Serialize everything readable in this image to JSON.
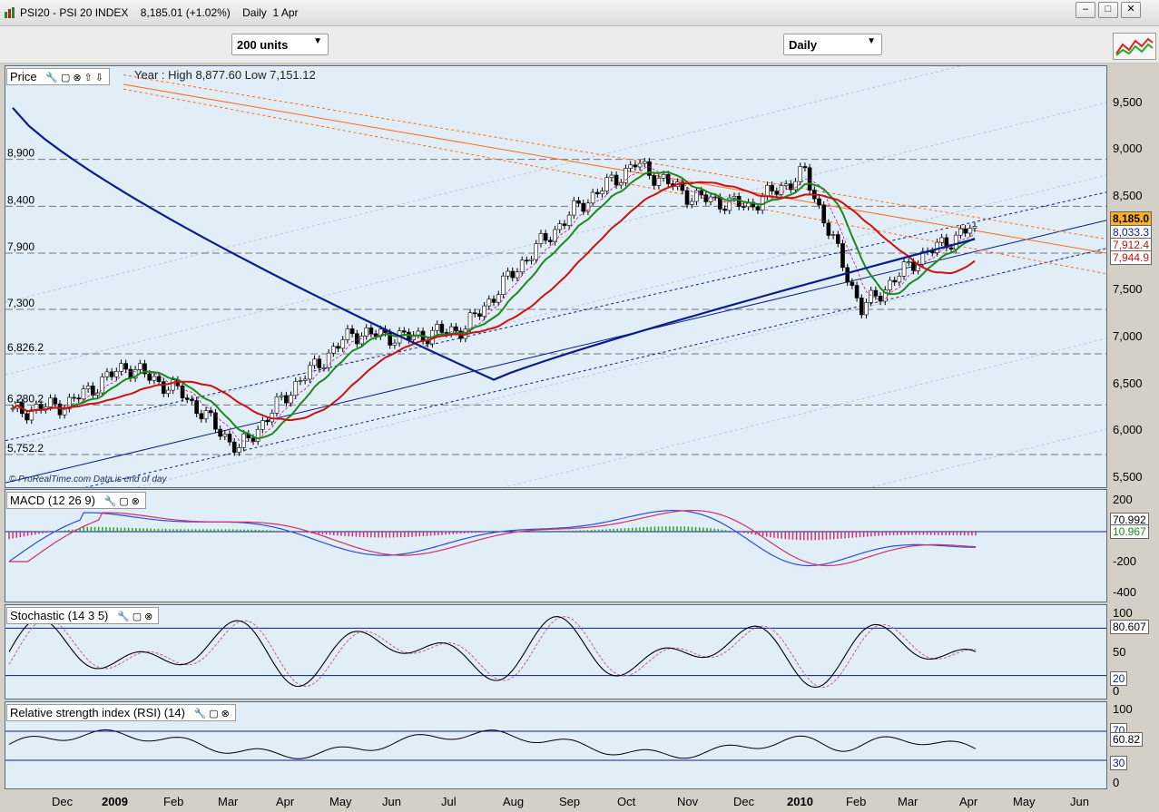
{
  "window": {
    "title": "PSI20 - PSI 20 INDEX    8,185.01 (+1.02%)    Daily  1 Apr",
    "buttons": [
      "–",
      "□",
      "✕"
    ]
  },
  "toolbar": {
    "units": "200 units",
    "period": "Daily",
    "tools_icon": "chart-tools-icon"
  },
  "price_panel": {
    "label": "Price",
    "stats": "Year : High 8,877.60 Low 7,151.12",
    "credit": "© ProRealTime.com  Data is end of day",
    "current_value": "8,185.0",
    "mid_value": "7,912.4",
    "overlay_value": "8,033.3",
    "overlay_value_2": "7,944.9",
    "level_labels": [
      "8,900",
      "8,400",
      "7,900",
      "7,300",
      "6,826.2",
      "6,280.2",
      "5,752.2"
    ],
    "y_ticks": [
      "9,500",
      "9,000",
      "8,500",
      "8,000",
      "7,500",
      "7,000",
      "6,500",
      "6,000",
      "5,500"
    ]
  },
  "macd_panel": {
    "label": "MACD (12 26 9)",
    "y_ticks": [
      "200",
      "0",
      "-200",
      "-400"
    ],
    "value_1": "70.992",
    "value_2": "10.967"
  },
  "stoch_panel": {
    "label": "Stochastic (14 3 5)",
    "y_ticks": [
      "100",
      "50",
      "0"
    ],
    "value": "80.607",
    "line_value": "20"
  },
  "rsi_panel": {
    "label": "Relative strength index (RSI) (14)",
    "y_ticks": [
      "100",
      "0"
    ],
    "value": "60.82",
    "upper_line": "70",
    "lower_line": "30"
  },
  "x_axis": [
    "Dec",
    "2009",
    "Feb",
    "Mar",
    "Apr",
    "May",
    "Jun",
    "Jul",
    "Aug",
    "Sep",
    "Oct",
    "Nov",
    "Dec",
    "2010",
    "Feb",
    "Mar",
    "Apr",
    "May",
    "Jun"
  ],
  "colors": {
    "background": "#e1eef7",
    "ma_short": "#1a8a1a",
    "ma_mid": "#cc1010",
    "ma_long": "#0b1d8c",
    "trend": "#ff6a1a"
  },
  "chart_data": {
    "type": "candlestick",
    "x": [
      "2008-11",
      "2008-12",
      "2009-01",
      "2009-02",
      "2009-03",
      "2009-04",
      "2009-05",
      "2009-06",
      "2009-07",
      "2009-08",
      "2009-09",
      "2009-10",
      "2009-11",
      "2009-12",
      "2010-01",
      "2010-02",
      "2010-03",
      "2010-04"
    ],
    "close": [
      6200,
      6300,
      6700,
      6400,
      5800,
      6500,
      7050,
      7000,
      7100,
      7800,
      8400,
      8850,
      8500,
      8400,
      8750,
      7300,
      7850,
      8185
    ],
    "ylim": [
      5500,
      9700
    ],
    "series": [
      {
        "name": "MACD",
        "last": 70.992
      },
      {
        "name": "Signal",
        "last": 10.967
      },
      {
        "name": "Stochastic",
        "last": 80.607
      },
      {
        "name": "RSI",
        "last": 60.82
      }
    ]
  }
}
